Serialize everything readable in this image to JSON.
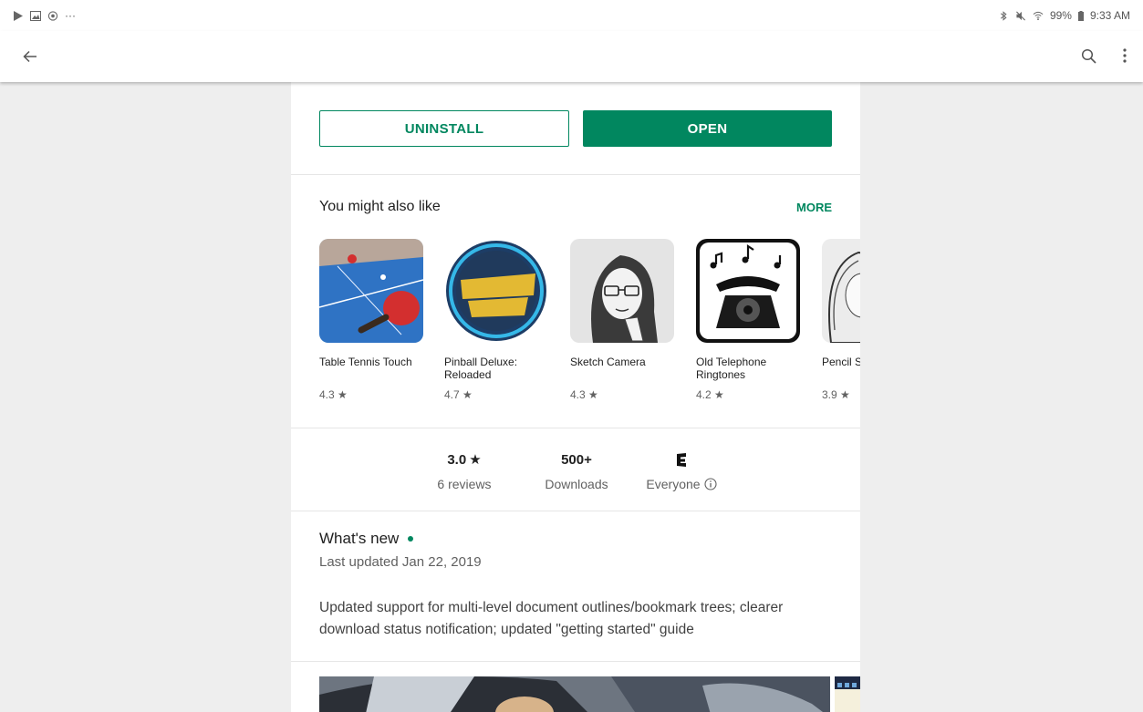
{
  "status_bar": {
    "battery": "99%",
    "time": "9:33 AM",
    "notification_more": "···"
  },
  "actions": {
    "uninstall_label": "UNINSTALL",
    "open_label": "OPEN"
  },
  "similar": {
    "title": "You might also like",
    "more_label": "MORE",
    "apps": [
      {
        "name": "Table Tennis Touch",
        "rating": "4.3 ★"
      },
      {
        "name": "Pinball Deluxe: Reloaded",
        "rating": "4.7 ★"
      },
      {
        "name": "Sketch Camera",
        "rating": "4.3 ★"
      },
      {
        "name": "Old Telephone Ringtones",
        "rating": "4.2 ★"
      },
      {
        "name": "Pencil Sketch",
        "rating": "3.9 ★"
      }
    ]
  },
  "stats": {
    "rating_value": "3.0",
    "rating_star": "★",
    "reviews": "6 reviews",
    "downloads_value": "500+",
    "downloads_label": "Downloads",
    "content_rating": "Everyone"
  },
  "whats_new": {
    "title": "What's new",
    "date": "Last updated Jan 22, 2019",
    "body": "Updated support for multi-level document outlines/bookmark trees; clearer download status notification; updated \"getting started\" guide"
  },
  "colors": {
    "accent": "#01875f",
    "background": "#eeeeee",
    "card": "#ffffff"
  }
}
